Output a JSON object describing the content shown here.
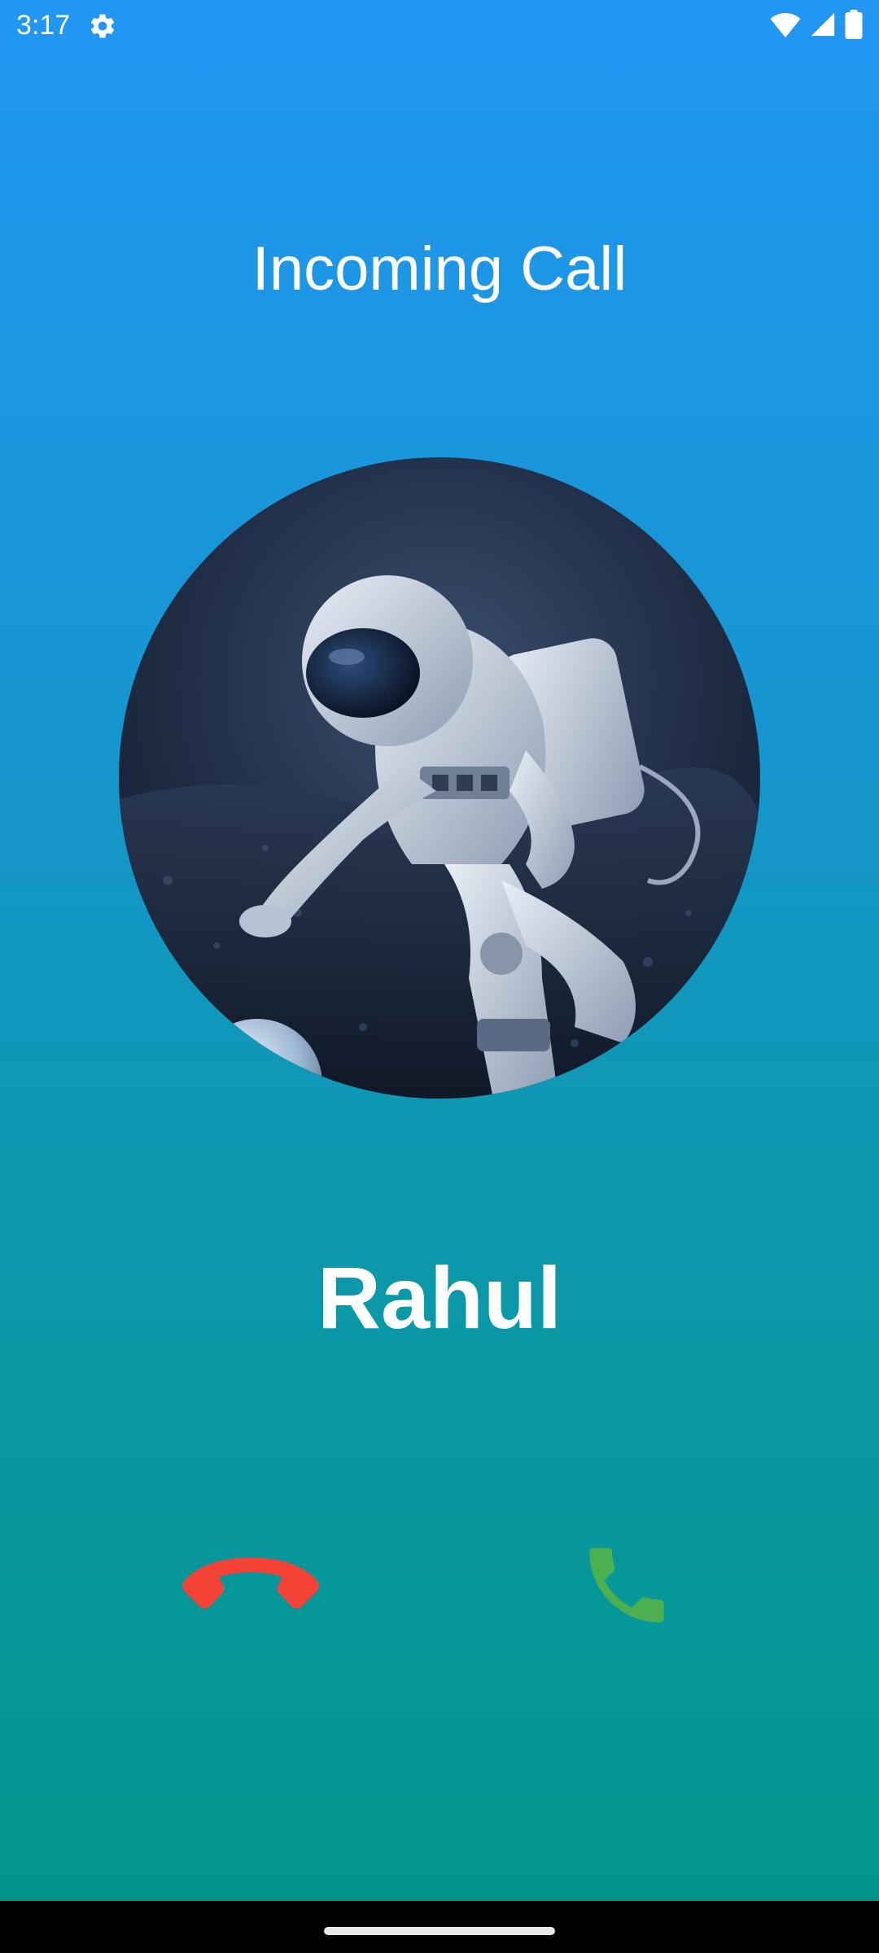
{
  "status_bar": {
    "time": "3:17",
    "settings_icon": "gear-icon",
    "wifi_icon": "wifi-icon",
    "signal_icon": "cellular-signal-icon",
    "battery_icon": "battery-icon"
  },
  "call": {
    "title": "Incoming Call",
    "caller_name": "Rahul",
    "avatar_description_icon": "astronaut-avatar",
    "decline_icon": "call-end-icon",
    "accept_icon": "call-accept-icon",
    "decline_color": "#F44336",
    "accept_color": "#4CAF50"
  },
  "colors": {
    "gradient_top": "#2196F3",
    "gradient_bottom": "#009688"
  }
}
